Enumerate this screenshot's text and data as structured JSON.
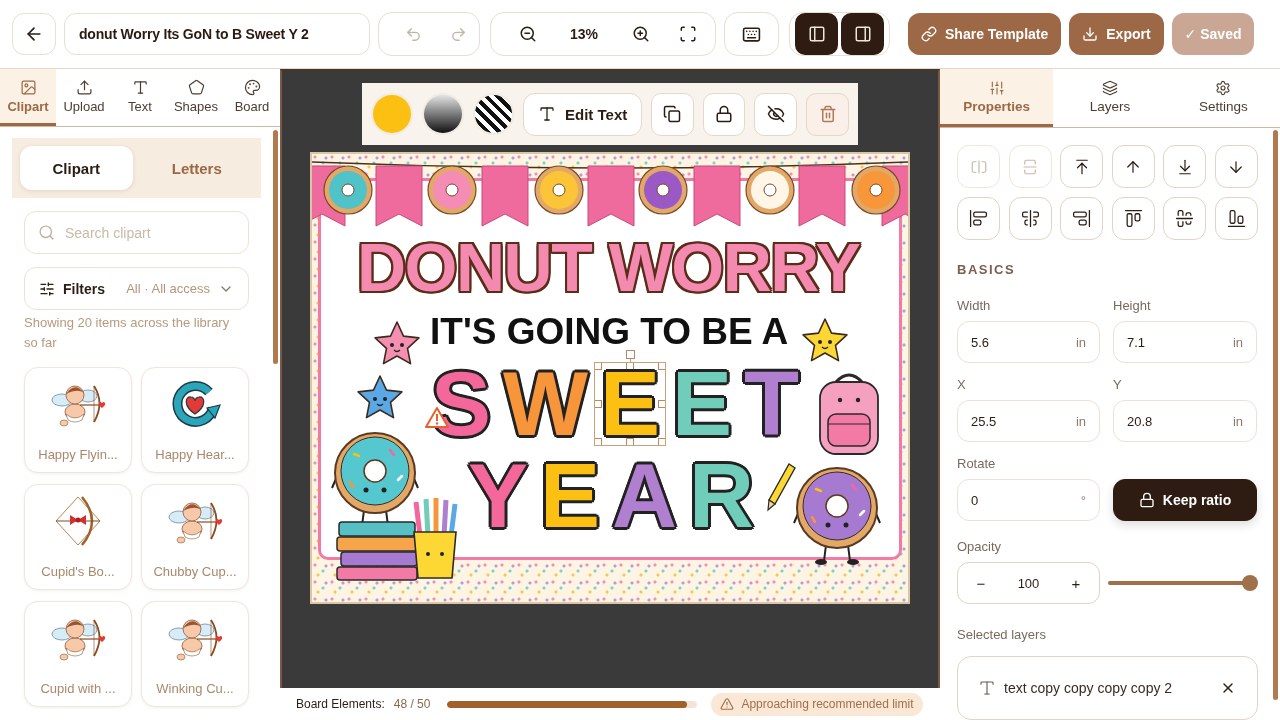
{
  "topbar": {
    "title": "donut Worry Its GoN to B Sweet Y 2",
    "undo": {
      "disabled": true
    },
    "redo": {
      "disabled": true
    },
    "zoom": "13%",
    "panel_toggles": [
      {
        "kind": "left",
        "on": true
      },
      {
        "kind": "right",
        "on": true
      }
    ],
    "actions": [
      {
        "kind": "share",
        "label": "Share Template",
        "disabled": false
      },
      {
        "kind": "export",
        "label": "Export",
        "disabled": false
      },
      {
        "kind": "saved",
        "label": "✓ Saved",
        "disabled": true
      }
    ]
  },
  "left_panel": {
    "tabs": [
      {
        "label": "Clipart",
        "selected": true
      },
      {
        "label": "Upload",
        "selected": false
      },
      {
        "label": "Text",
        "selected": false
      },
      {
        "label": "Shapes",
        "selected": false
      },
      {
        "label": "Board",
        "selected": false
      }
    ],
    "segments": [
      {
        "label": "Clipart",
        "selected": true
      },
      {
        "label": "Letters",
        "selected": false
      }
    ],
    "search": {
      "placeholder": "Search clipart"
    },
    "filters": {
      "label": "Filters",
      "value": "All · All access"
    },
    "summary": "Showing 20 items across the library so far",
    "items": [
      {
        "label": "Happy Flyin..."
      },
      {
        "label": "Happy Hear..."
      },
      {
        "label": "Cupid's Bo..."
      },
      {
        "label": "Chubby Cup..."
      },
      {
        "label": "Cupid with ..."
      },
      {
        "label": "Winking Cu..."
      }
    ]
  },
  "toolbar": {
    "swatches": [
      {
        "kind": "solid",
        "color": "#fcc012"
      },
      {
        "kind": "gradient"
      },
      {
        "kind": "pattern"
      }
    ],
    "edit_text": "Edit Text"
  },
  "board": {
    "headline": "DONUT WORRY",
    "subline": "IT'S GOING TO BE A",
    "words": [
      {
        "letters": [
          {
            "text": "S",
            "color": "#f4679b",
            "selected": false
          },
          {
            "text": "W",
            "color": "#f7953a",
            "selected": false
          },
          {
            "text": "E",
            "color": "#fcc012",
            "selected": true
          },
          {
            "text": "E",
            "color": "#6fcdb9",
            "selected": false
          },
          {
            "text": "T",
            "color": "#b07fcf",
            "selected": false
          }
        ]
      },
      {
        "letters": [
          {
            "text": "Y",
            "color": "#f4679b",
            "selected": false
          },
          {
            "text": "E",
            "color": "#fcc012",
            "selected": false
          },
          {
            "text": "A",
            "color": "#b07fcf",
            "selected": false
          },
          {
            "text": "R",
            "color": "#6fcdb9",
            "selected": false
          }
        ]
      }
    ]
  },
  "status_bar": {
    "label": "Board Elements:",
    "count": "48 / 50",
    "level": 0.96,
    "warning": "Approaching recommended limit"
  },
  "right_panel": {
    "tabs": [
      {
        "label": "Properties",
        "selected": true
      },
      {
        "label": "Layers",
        "selected": false
      },
      {
        "label": "Settings",
        "selected": false
      }
    ],
    "arrange_buttons": [
      {
        "disabled": true
      },
      {
        "disabled": true
      },
      {
        "disabled": false
      },
      {
        "disabled": false
      },
      {
        "disabled": false
      },
      {
        "disabled": false
      }
    ],
    "section": "BASICS",
    "fields": [
      {
        "label": "Width",
        "value": "5.6",
        "unit": "in"
      },
      {
        "label": "Height",
        "value": "7.1",
        "unit": "in"
      },
      {
        "label": "X",
        "value": "25.5",
        "unit": "in"
      },
      {
        "label": "Y",
        "value": "20.8",
        "unit": "in"
      },
      {
        "label": "Rotate",
        "value": "0",
        "unit": "°"
      }
    ],
    "keep_ratio": {
      "label": "Keep ratio",
      "on": true
    },
    "opacity": {
      "label": "Opacity",
      "minus": "−",
      "value": "100",
      "plus": "+",
      "level": 1
    },
    "selected_layers": {
      "label": "Selected layers",
      "items": [
        {
          "name": "text copy copy copy copy 2"
        }
      ]
    }
  }
}
